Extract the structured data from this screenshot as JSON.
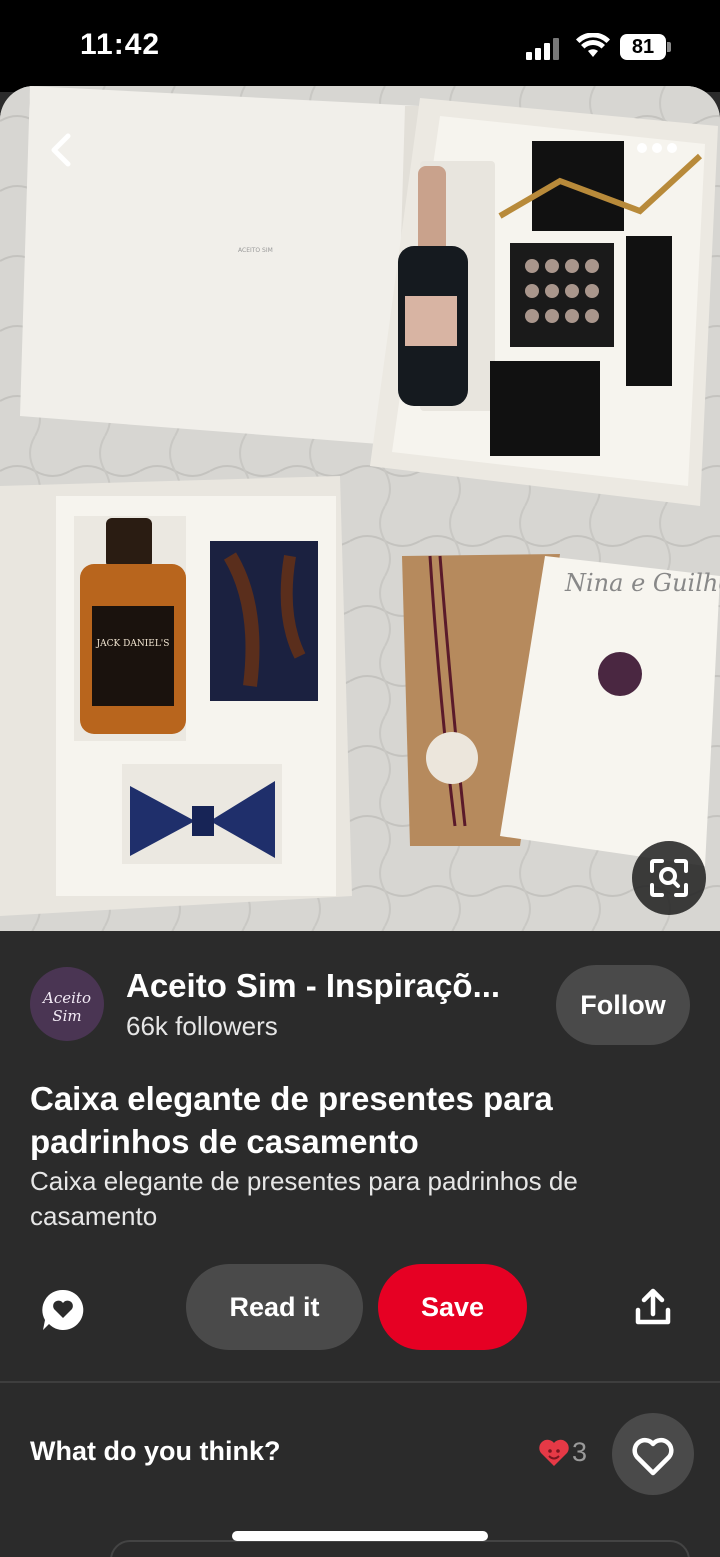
{
  "status_bar": {
    "time": "11:42",
    "battery": "81",
    "icons": [
      "signal-icon",
      "wifi-icon",
      "battery-icon"
    ]
  },
  "pin": {
    "image_text": {
      "bottle_label": "JACK DANIEL'S",
      "invitation_names": "Nina e Guilherme"
    },
    "creator": {
      "avatar_text": "Aceito Sim",
      "name": "Aceito Sim - Inspiraçõ...",
      "followers": "66k followers",
      "follow_label": "Follow"
    },
    "title": "Caixa elegante de presentes para padrinhos de casamento",
    "description": "Caixa elegante de presentes para padrinhos de casamento",
    "actions": {
      "read_label": "Read it",
      "save_label": "Save"
    },
    "comments": {
      "prompt": "What do you think?",
      "reaction_count": "3"
    }
  },
  "colors": {
    "save": "#e60023",
    "background": "#2b2b2b",
    "button": "#4a4a4a",
    "heart": "#e63946"
  }
}
